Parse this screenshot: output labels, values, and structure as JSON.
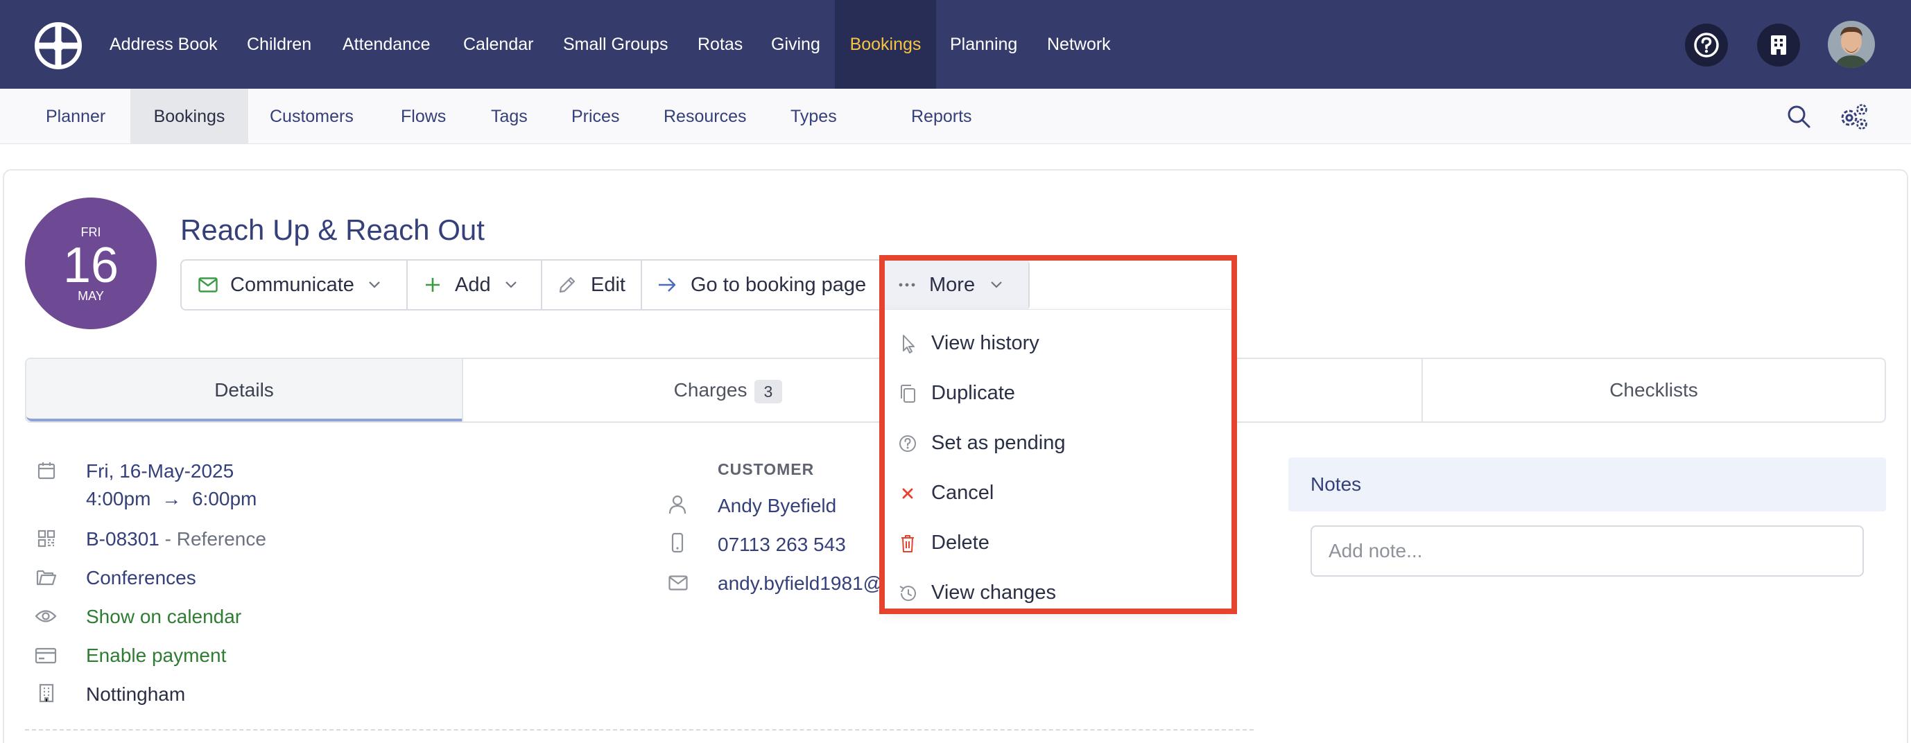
{
  "topnav": {
    "items": [
      "Address Book",
      "Children",
      "Attendance",
      "Calendar",
      "Small Groups",
      "Rotas",
      "Giving",
      "Bookings",
      "Planning",
      "Network"
    ],
    "active": "Bookings",
    "icons": [
      "help-icon",
      "building-icon",
      "avatar"
    ]
  },
  "subnav": {
    "items": [
      "Planner",
      "Bookings",
      "Customers",
      "Flows",
      "Tags",
      "Prices",
      "Resources",
      "Types",
      "Reports"
    ],
    "active": "Bookings"
  },
  "booking": {
    "date_badge": {
      "dow": "FRI",
      "day": "16",
      "month": "MAY"
    },
    "title": "Reach Up & Reach Out"
  },
  "actions": {
    "communicate": "Communicate",
    "add": "Add",
    "edit": "Edit",
    "go_to_booking_page": "Go to booking page",
    "more": "More"
  },
  "more_menu": [
    {
      "label": "View history",
      "icon": "cursor-icon"
    },
    {
      "label": "Duplicate",
      "icon": "copy-icon"
    },
    {
      "label": "Set as pending",
      "icon": "question-circle-icon"
    },
    {
      "label": "Cancel",
      "icon": "close-icon"
    },
    {
      "label": "Delete",
      "icon": "trash-icon"
    },
    {
      "label": "View changes",
      "icon": "history-icon"
    }
  ],
  "tabs": {
    "details": "Details",
    "charges": "Charges",
    "charges_count": "3",
    "checklists": "Checklists"
  },
  "details": {
    "date": "Fri, 16-May-2025",
    "time_start": "4:00pm",
    "arrow": "→",
    "time_end": "6:00pm",
    "reference_code": "B-08301",
    "reference_label": "- Reference",
    "type": "Conferences",
    "show_on_calendar": "Show on calendar",
    "enable_payment": "Enable payment",
    "location": "Nottingham"
  },
  "customer": {
    "label": "CUSTOMER",
    "name": "Andy Byefield",
    "phone": "07113 263 543",
    "email": "andy.byfield1981@"
  },
  "notes": {
    "label": "Notes",
    "placeholder": "Add note..."
  },
  "colors": {
    "nav_bg": "#353c6b",
    "nav_active_bg": "#272d55",
    "nav_active_text": "#f6c343",
    "date_badge": "#6e4a94",
    "link": "#35407a",
    "green": "#2e7d32",
    "danger": "#e5432e"
  }
}
